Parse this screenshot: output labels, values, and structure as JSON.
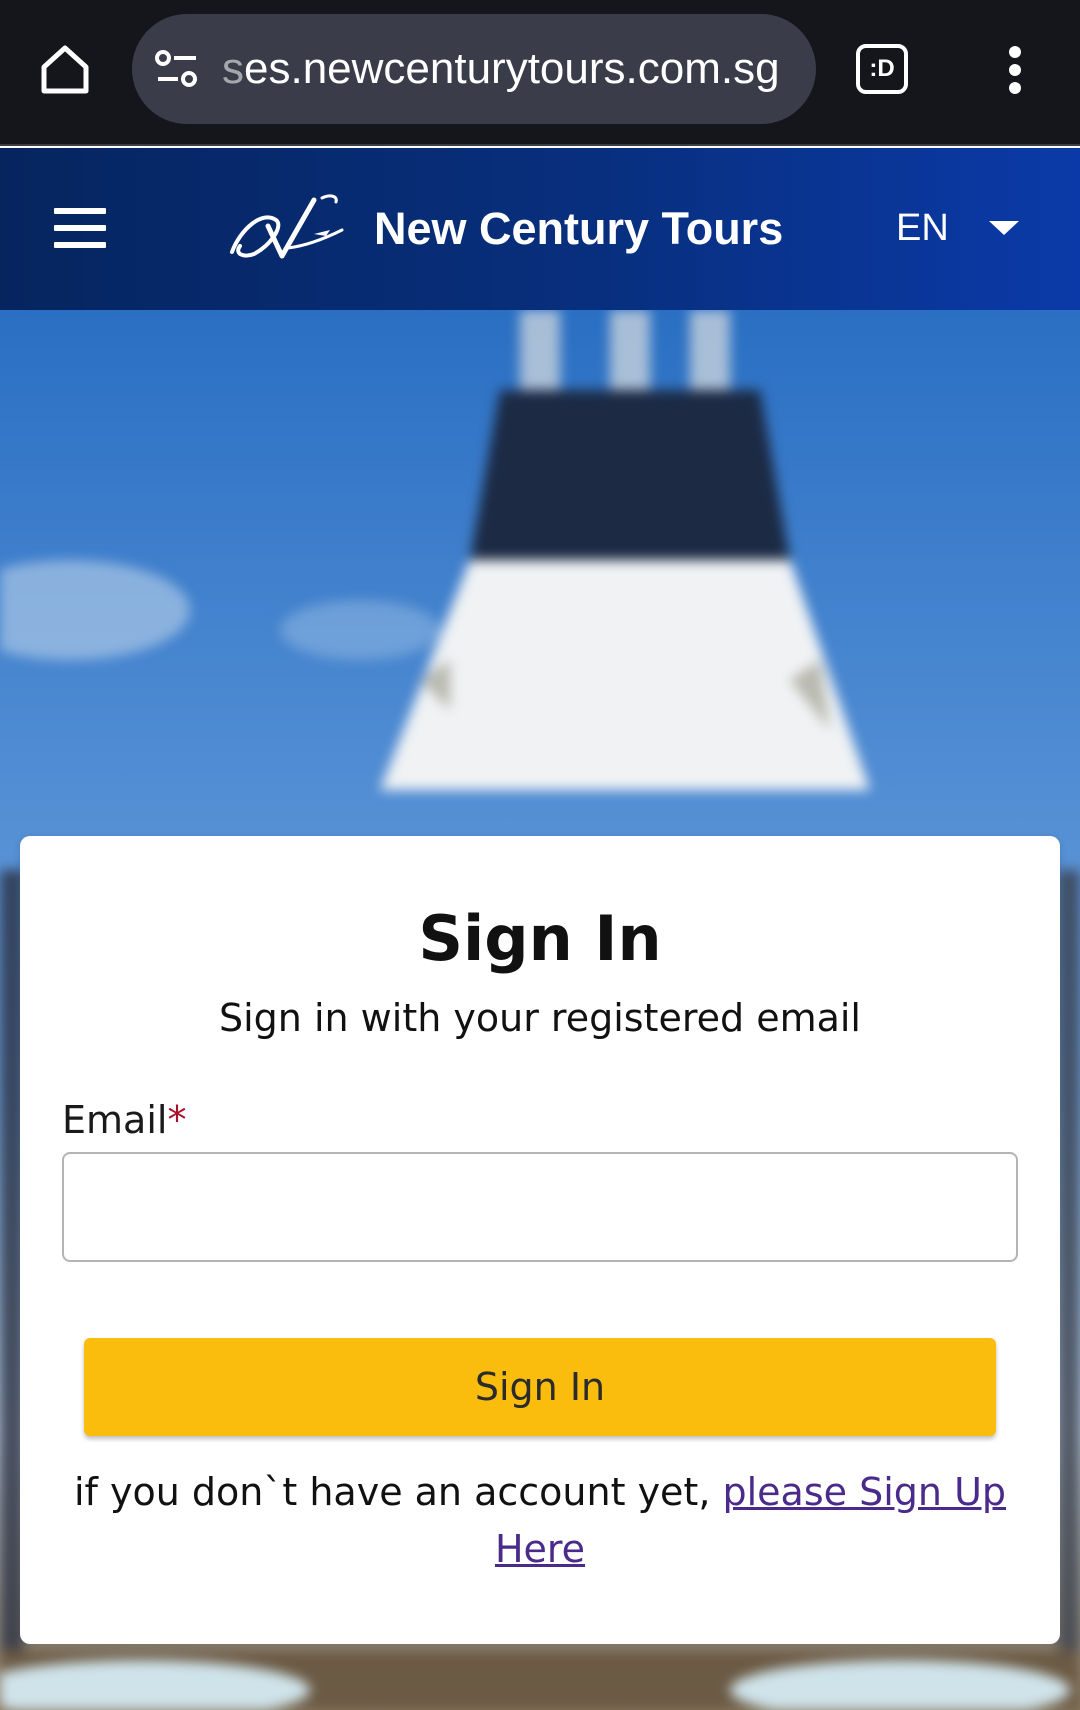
{
  "browser": {
    "url_faded": "s",
    "url_main": "es.newcenturytours.com.sg",
    "extension_label": ":D"
  },
  "header": {
    "brand_name": "New Century Tours",
    "language": "EN",
    "background_colors": [
      "#06255f",
      "#0b3aa8"
    ]
  },
  "signin": {
    "title": "Sign In",
    "subtitle": "Sign in with your registered email",
    "email_label": "Email",
    "required_marker": "*",
    "email_value": "",
    "button_label": "Sign In",
    "button_color": "#fbbd0d",
    "signup_prompt": "if you don`t have an account yet, ",
    "signup_link": "please Sign Up Here",
    "link_color": "#4a2a8a"
  },
  "icons": [
    "home-icon",
    "site-settings-icon",
    "extension-icon",
    "more-vert-icon",
    "hamburger-menu-icon",
    "brand-logo",
    "dropdown-caret-icon"
  ]
}
